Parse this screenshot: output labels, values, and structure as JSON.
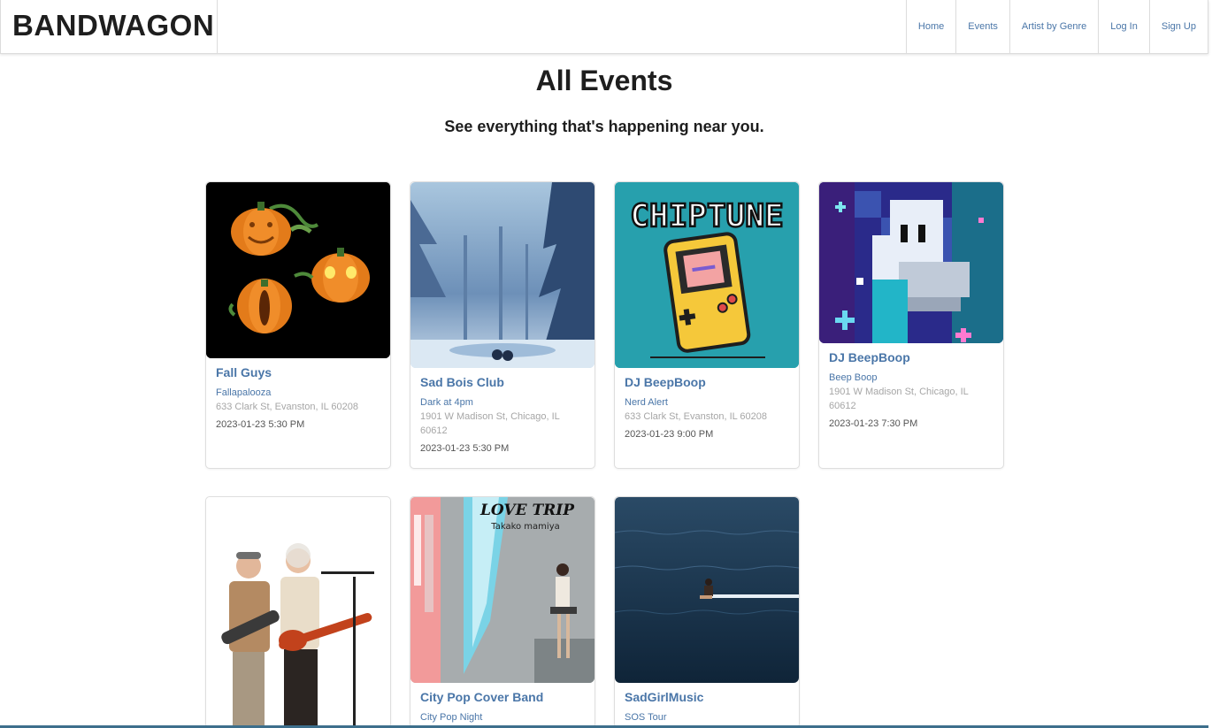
{
  "header": {
    "brand": "BANDWAGON",
    "nav": [
      "Home",
      "Events",
      "Artist by Genre",
      "Log In",
      "Sign Up"
    ]
  },
  "main": {
    "title": "All Events",
    "subtitle": "See everything that's happening near you."
  },
  "events": [
    {
      "artist": "Fall Guys",
      "event": "Fallapalooza",
      "address": "633 Clark St, Evanston, IL 60208",
      "datetime": "2023-01-23 5:30 PM",
      "image": "pumpkins-image"
    },
    {
      "artist": "Sad Bois Club",
      "event": "Dark at 4pm",
      "address": "1901 W Madison St, Chicago, IL 60612",
      "datetime": "2023-01-23 5:30 PM",
      "image": "snowy-forest-image"
    },
    {
      "artist": "DJ BeepBoop",
      "event": "Nerd Alert",
      "address": "633 Clark St, Evanston, IL 60208",
      "datetime": "2023-01-23 9:00 PM",
      "image": "chiptune-image"
    },
    {
      "artist": "DJ BeepBoop",
      "event": "Beep Boop",
      "address": "1901 W Madison St, Chicago, IL 60612",
      "datetime": "2023-01-23 7:30 PM",
      "image": "pixel-ghost-image"
    },
    {
      "artist": "",
      "event": "",
      "address": "",
      "datetime": "",
      "image": "elderly-band-image"
    },
    {
      "artist": "City Pop Cover Band",
      "event": "City Pop Night",
      "address": "",
      "datetime": "",
      "image": "love-trip-album-image",
      "album_title": "LOVE TRIP",
      "album_artist": "Takako mamiya"
    },
    {
      "artist": "SadGirlMusic",
      "event": "SOS Tour",
      "address": "",
      "datetime": "",
      "image": "ocean-image"
    }
  ],
  "chiptune_text": "CHIPTUNE",
  "colors": {
    "link": "#4a76a8",
    "muted": "#a6a6a6",
    "border": "#dedede"
  }
}
